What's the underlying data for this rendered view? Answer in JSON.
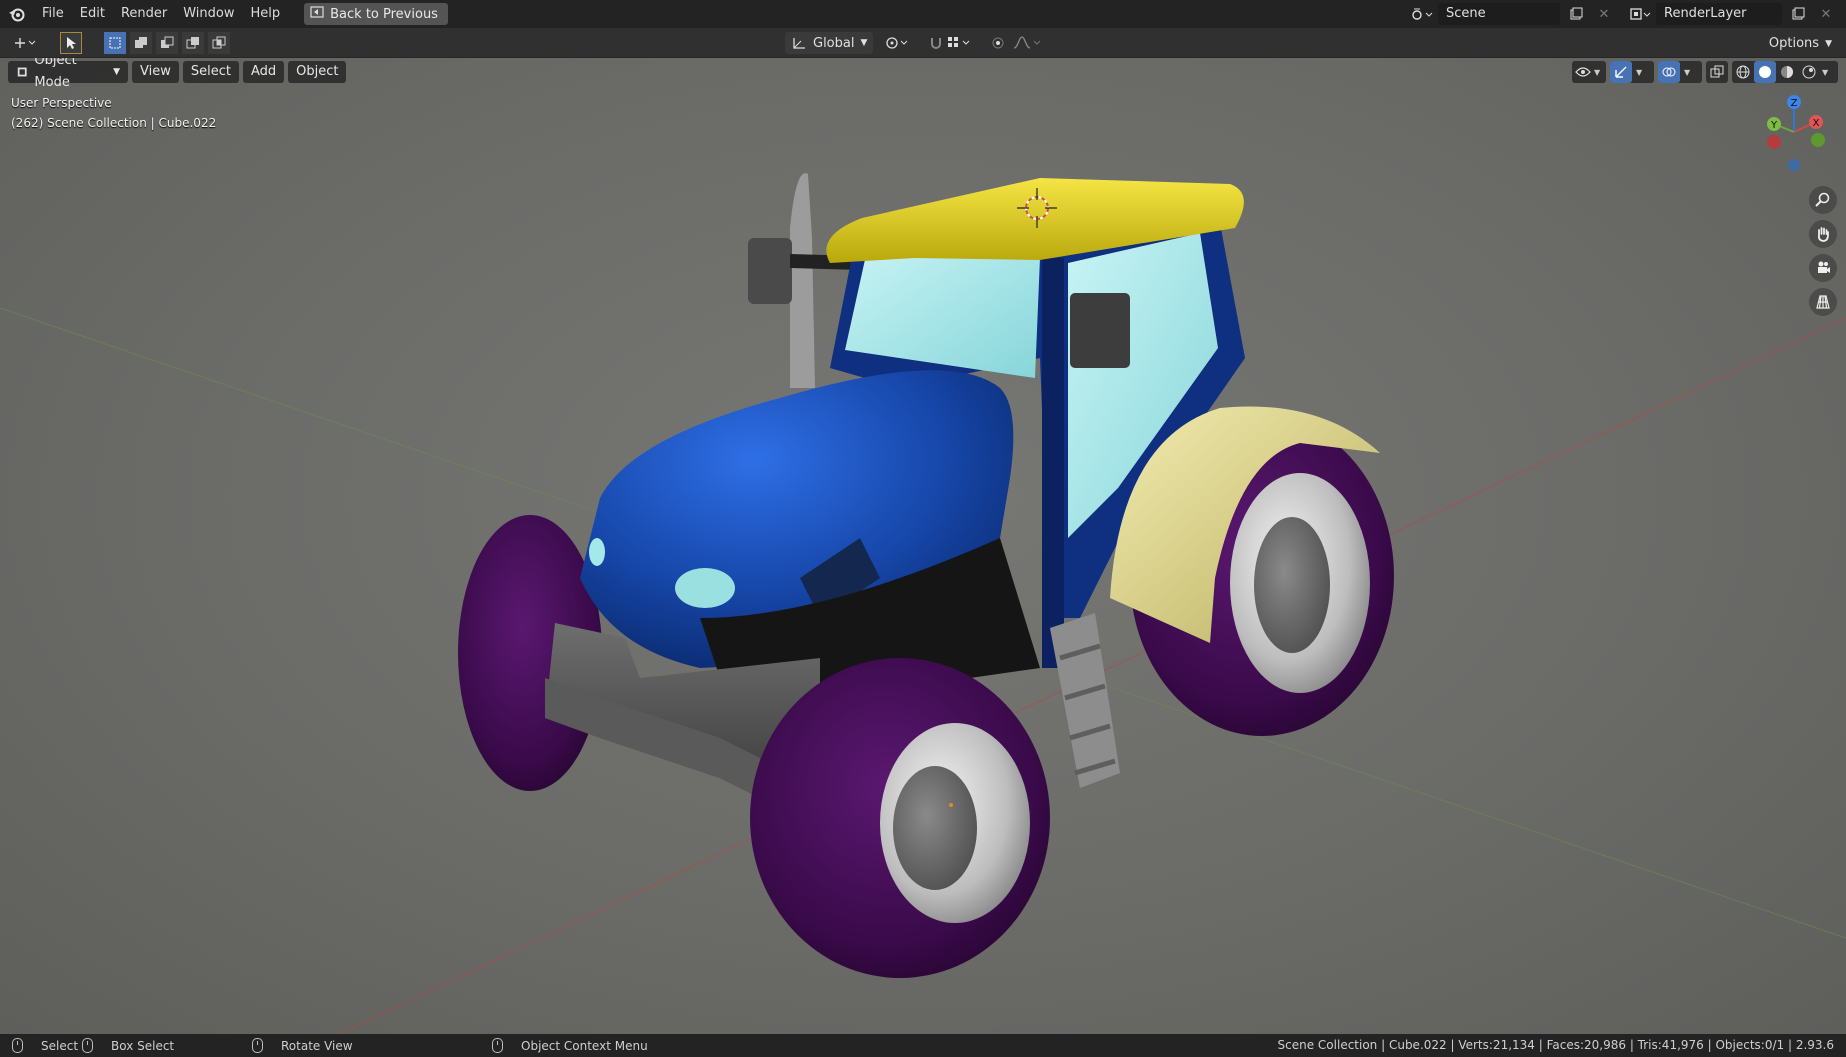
{
  "menubar": {
    "items": [
      "File",
      "Edit",
      "Render",
      "Window",
      "Help"
    ],
    "back_button": "Back to Previous",
    "scene_name": "Scene",
    "render_layer": "RenderLayer"
  },
  "toolheader": {
    "orientation": "Global",
    "options": "Options"
  },
  "viewport_header": {
    "mode": "Object Mode",
    "menus": [
      "View",
      "Select",
      "Add",
      "Object"
    ]
  },
  "overlay": {
    "perspective": "User Perspective",
    "collection": "(262) Scene Collection | Cube.022"
  },
  "gizmo": {
    "x_label": "X",
    "y_label": "Y",
    "z_label": "Z"
  },
  "statusbar": {
    "select": "Select",
    "box_select": "Box Select",
    "rotate_view": "Rotate View",
    "context_menu": "Object Context Menu",
    "stats": "Scene Collection | Cube.022 | Verts:21,134 | Faces:20,986 | Tris:41,976 | Objects:0/1 | 2.93.6"
  },
  "colors": {
    "accent": "#4772b3",
    "tractor_body": "#1d4fb5",
    "tractor_roof": "#e6d21a",
    "fender": "#e8df92",
    "tire": "#3b0a4a",
    "glass": "#9fe3e6"
  }
}
